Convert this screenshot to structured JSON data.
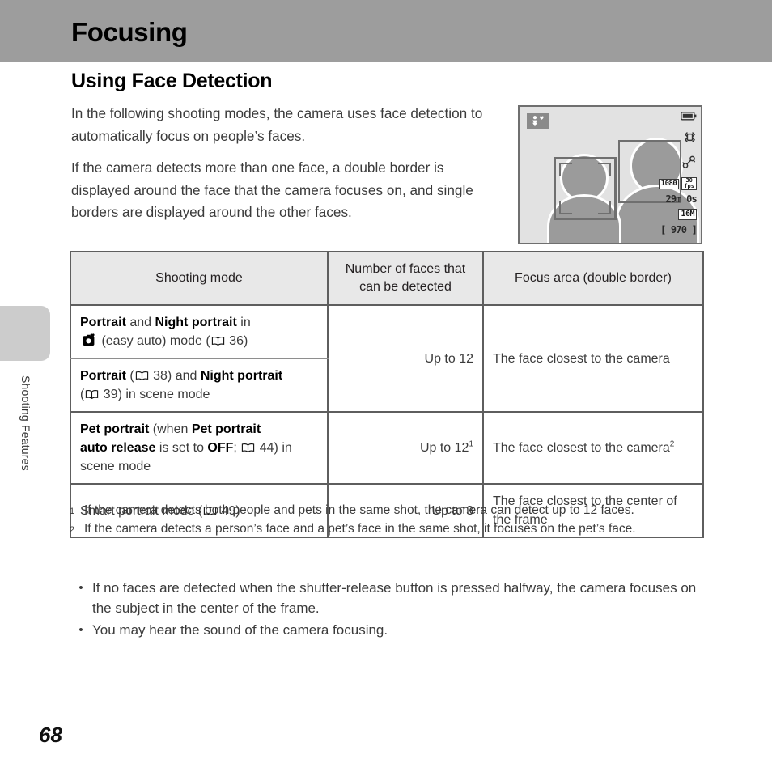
{
  "header": {
    "title": "Focusing",
    "banner_color": "#9d9d9d"
  },
  "section": {
    "heading": "Using Face Detection",
    "paragraphs": [
      "In the following shooting modes, the camera uses face detection to automatically focus on people’s faces.",
      "If the camera detects more than one face, a double border is displayed around the face that the camera focuses on, and single borders are displayed around the other faces."
    ]
  },
  "side_tab": {
    "label": "Shooting Features"
  },
  "camera_display": {
    "mode_icon": "night-portrait-icon",
    "osd": {
      "battery": "battery-icon",
      "vr": "vibration-reduction-icon",
      "wind_noise": "wind-noise-icon",
      "movie_size": "1080",
      "frame_rate_top": "30",
      "frame_rate_bottom": "fps",
      "remaining_time": "29m 0s",
      "image_size": "16M",
      "shots_remaining": "[ 970 ]"
    },
    "focus_double_border": "double-border-focus-area",
    "focus_single_border": "single-border-face-area"
  },
  "table": {
    "headers": [
      "Shooting mode",
      "Number of faces that can be detected",
      "Focus area (double border)"
    ],
    "rows": [
      {
        "mode_parts": [
          {
            "text": "Portrait",
            "bold": true
          },
          {
            "text": " and ",
            "bold": false
          },
          {
            "text": "Night portrait",
            "bold": true
          },
          {
            "text": " in",
            "bold": false
          },
          {
            "text": "\n",
            "bold": false
          },
          {
            "icon": "easy-auto-icon"
          },
          {
            "text": " (easy auto) mode (",
            "bold": false
          },
          {
            "icon": "book-icon"
          },
          {
            "text": " 36)",
            "bold": false
          }
        ],
        "count": "Up to 12",
        "count_sup": "",
        "area": "The face closest to the camera",
        "area_sup": ""
      },
      {
        "mode_parts": [
          {
            "text": "Portrait",
            "bold": true
          },
          {
            "text": " (",
            "bold": false
          },
          {
            "icon": "book-icon"
          },
          {
            "text": " 38) and ",
            "bold": false
          },
          {
            "text": "Night portrait",
            "bold": true
          },
          {
            "text": "\n(",
            "bold": false
          },
          {
            "icon": "book-icon"
          },
          {
            "text": " 39) in scene mode",
            "bold": false
          }
        ]
      },
      {
        "mode_parts": [
          {
            "text": "Pet portrait",
            "bold": true
          },
          {
            "text": " (when ",
            "bold": false
          },
          {
            "text": "Pet portrait",
            "bold": true
          },
          {
            "text": "\n",
            "bold": false
          },
          {
            "text": "auto release",
            "bold": true
          },
          {
            "text": " is set to ",
            "bold": false
          },
          {
            "text": "OFF",
            "bold": true
          },
          {
            "text": "; ",
            "bold": false
          },
          {
            "icon": "book-icon"
          },
          {
            "text": " 44) in",
            "bold": false
          },
          {
            "text": "\nscene mode",
            "bold": false
          }
        ],
        "count": "Up to 12",
        "count_sup": "1",
        "area": "The face closest to the camera",
        "area_sup": "2"
      },
      {
        "mode_parts": [
          {
            "text": "Smart portrait mode (",
            "bold": false
          },
          {
            "icon": "book-icon"
          },
          {
            "text": " 49)",
            "bold": false
          }
        ],
        "count": "Up to 3",
        "count_sup": "",
        "area": "The face closest to the center of the frame",
        "area_sup": ""
      }
    ]
  },
  "footnotes": [
    {
      "mark": "1",
      "text": "If the camera detects both people and pets in the same shot, the camera can detect up to 12 faces."
    },
    {
      "mark": "2",
      "text": "If the camera detects a person’s face and a pet’s face in the same shot, it focuses on the pet’s face."
    }
  ],
  "bullets": [
    {
      "dot": "•",
      "text": "If no faces are detected when the shutter-release button is pressed halfway, the camera focuses on the subject in the center of the frame."
    },
    {
      "dot": "•",
      "text": "You may hear the sound of the camera focusing."
    }
  ],
  "page_number": "68"
}
